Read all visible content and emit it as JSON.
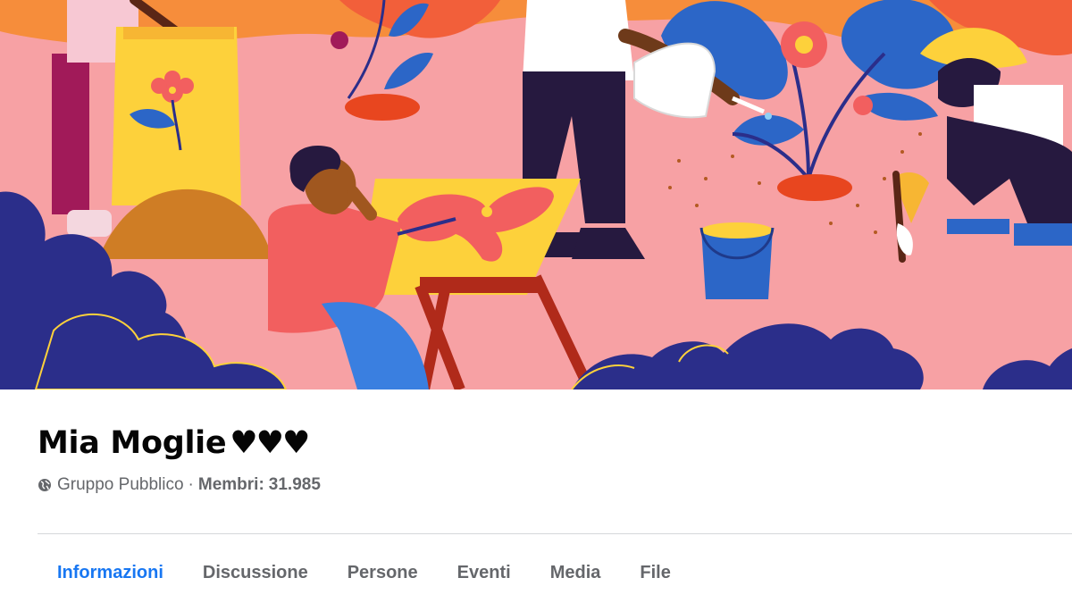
{
  "group": {
    "name": "Mia Moglie",
    "hearts": "♥♥♥",
    "privacy": "Gruppo Pubblico",
    "separator": "·",
    "members_label": "Membri:",
    "members_count": "31.985"
  },
  "tabs": [
    {
      "label": "Informazioni",
      "active": true
    },
    {
      "label": "Discussione"
    },
    {
      "label": "Persone"
    },
    {
      "label": "Eventi"
    },
    {
      "label": "Media"
    },
    {
      "label": "File"
    }
  ],
  "icons": {
    "privacy": "globe-icon"
  },
  "colors": {
    "accent": "#1877f2",
    "cover_background": "#f7a1a4",
    "text_primary": "#050505",
    "text_secondary": "#65676b"
  }
}
